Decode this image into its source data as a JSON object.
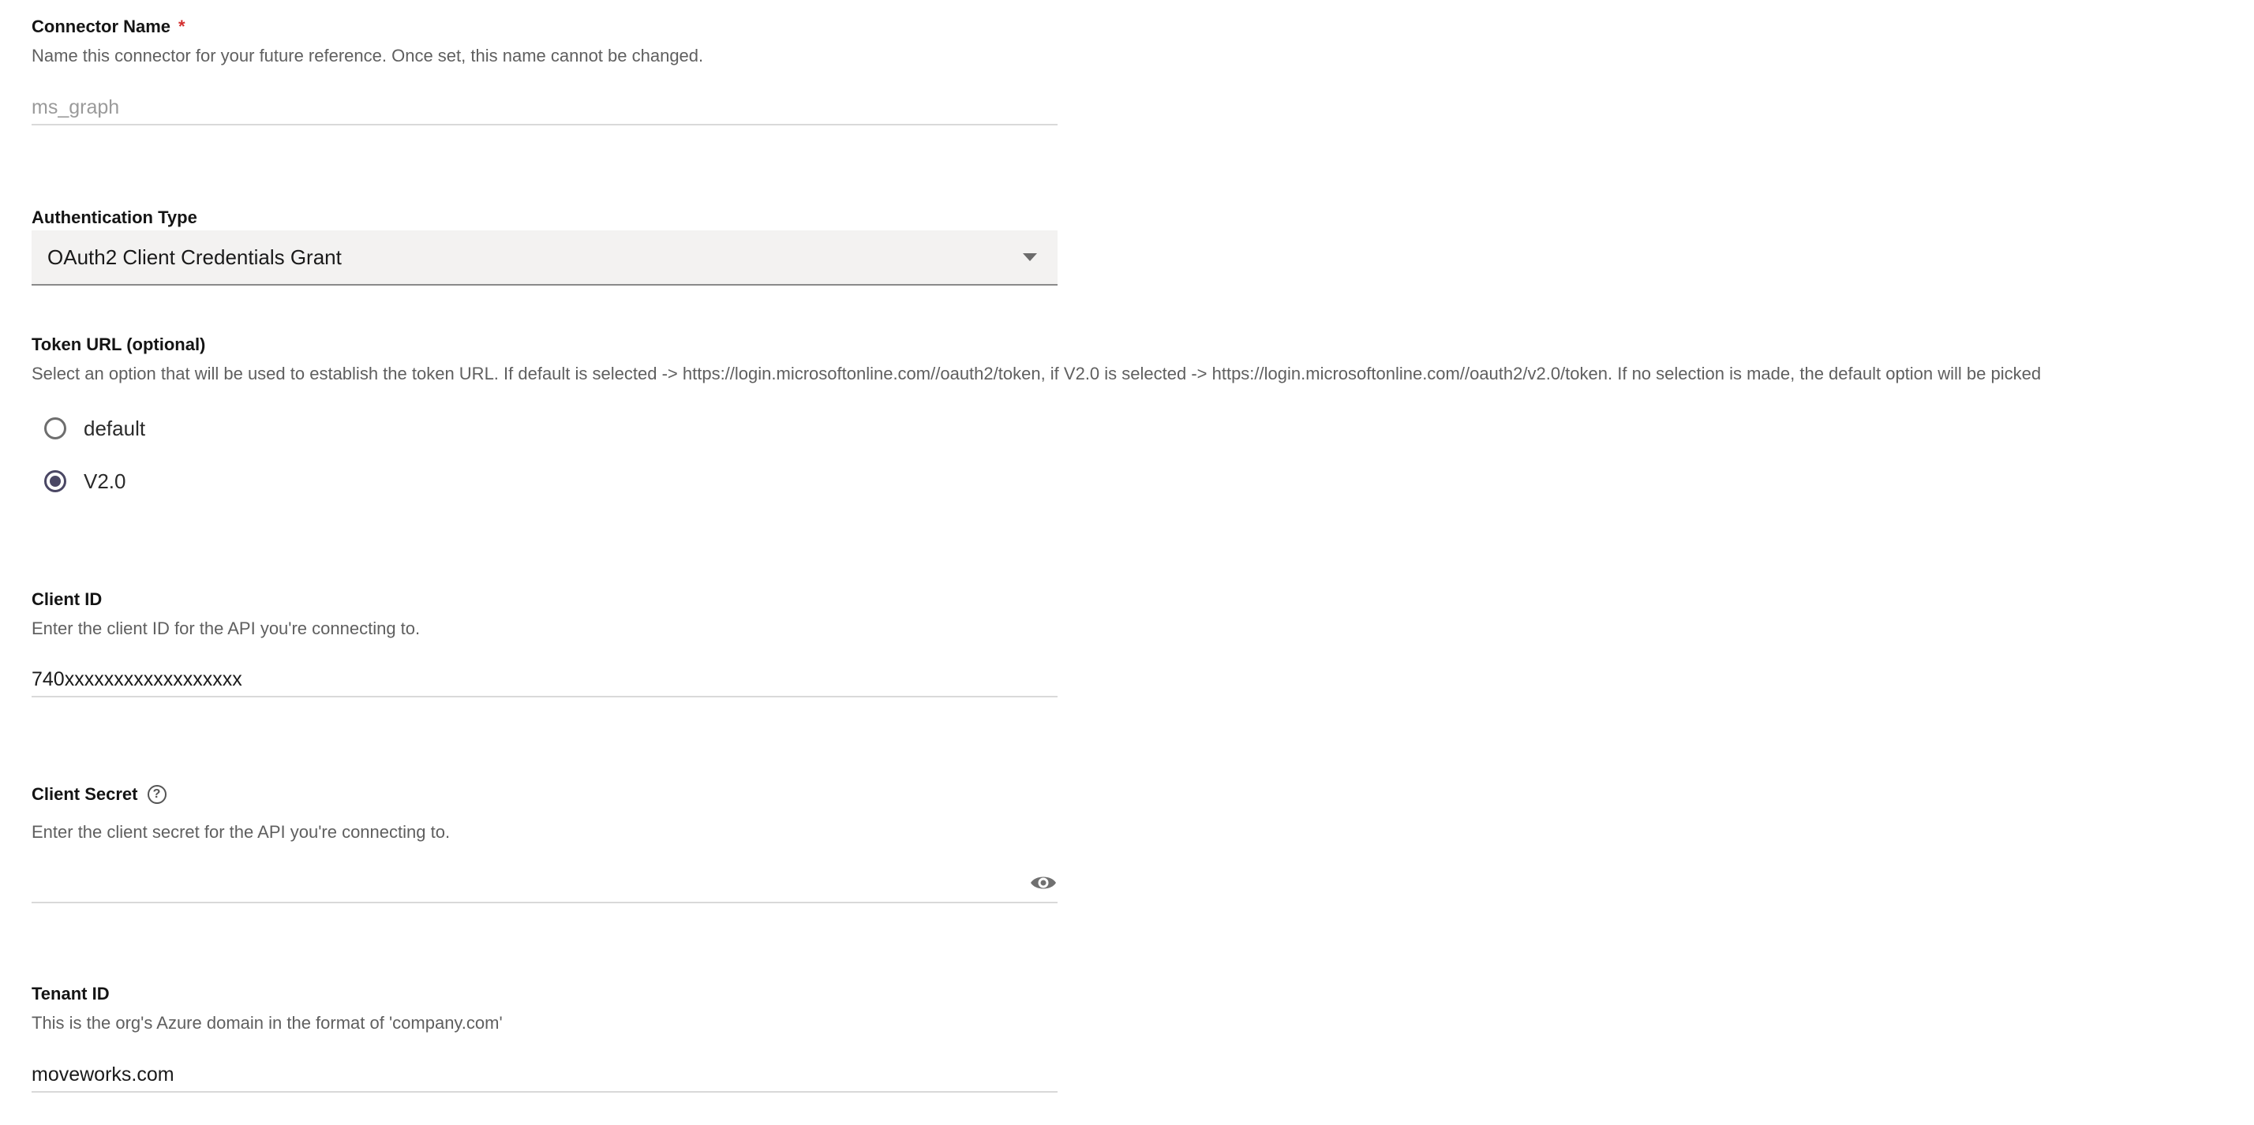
{
  "connector_name": {
    "label": "Connector Name",
    "required_mark": "*",
    "help": "Name this connector for your future reference. Once set, this name cannot be changed.",
    "placeholder": "ms_graph"
  },
  "auth_type": {
    "label": "Authentication Type",
    "value": "OAuth2 Client Credentials Grant"
  },
  "token_url": {
    "label": "Token URL (optional)",
    "help": "Select an option that will be used to establish the token URL. If default is selected -> https://login.microsoftonline.com//oauth2/token, if V2.0 is selected -> https://login.microsoftonline.com//oauth2/v2.0/token. If no selection is made, the default option will be picked",
    "options": [
      {
        "label": "default",
        "selected": false
      },
      {
        "label": "V2.0",
        "selected": true
      }
    ]
  },
  "client_id": {
    "label": "Client ID",
    "help": "Enter the client ID for the API you're connecting to.",
    "value": "740xxxxxxxxxxxxxxxxxx"
  },
  "client_secret": {
    "label": "Client Secret",
    "help_icon": "question-icon",
    "help": "Enter the client secret for the API you're connecting to.",
    "value": "",
    "visibility_icon": "eye-icon"
  },
  "tenant_id": {
    "label": "Tenant ID",
    "help": "This is the org's Azure domain in the format of 'company.com'",
    "value": "moveworks.com"
  },
  "colors": {
    "required": "#d32f2f",
    "radio_checked": "#4a4764",
    "select_bg": "#f3f2f1"
  }
}
